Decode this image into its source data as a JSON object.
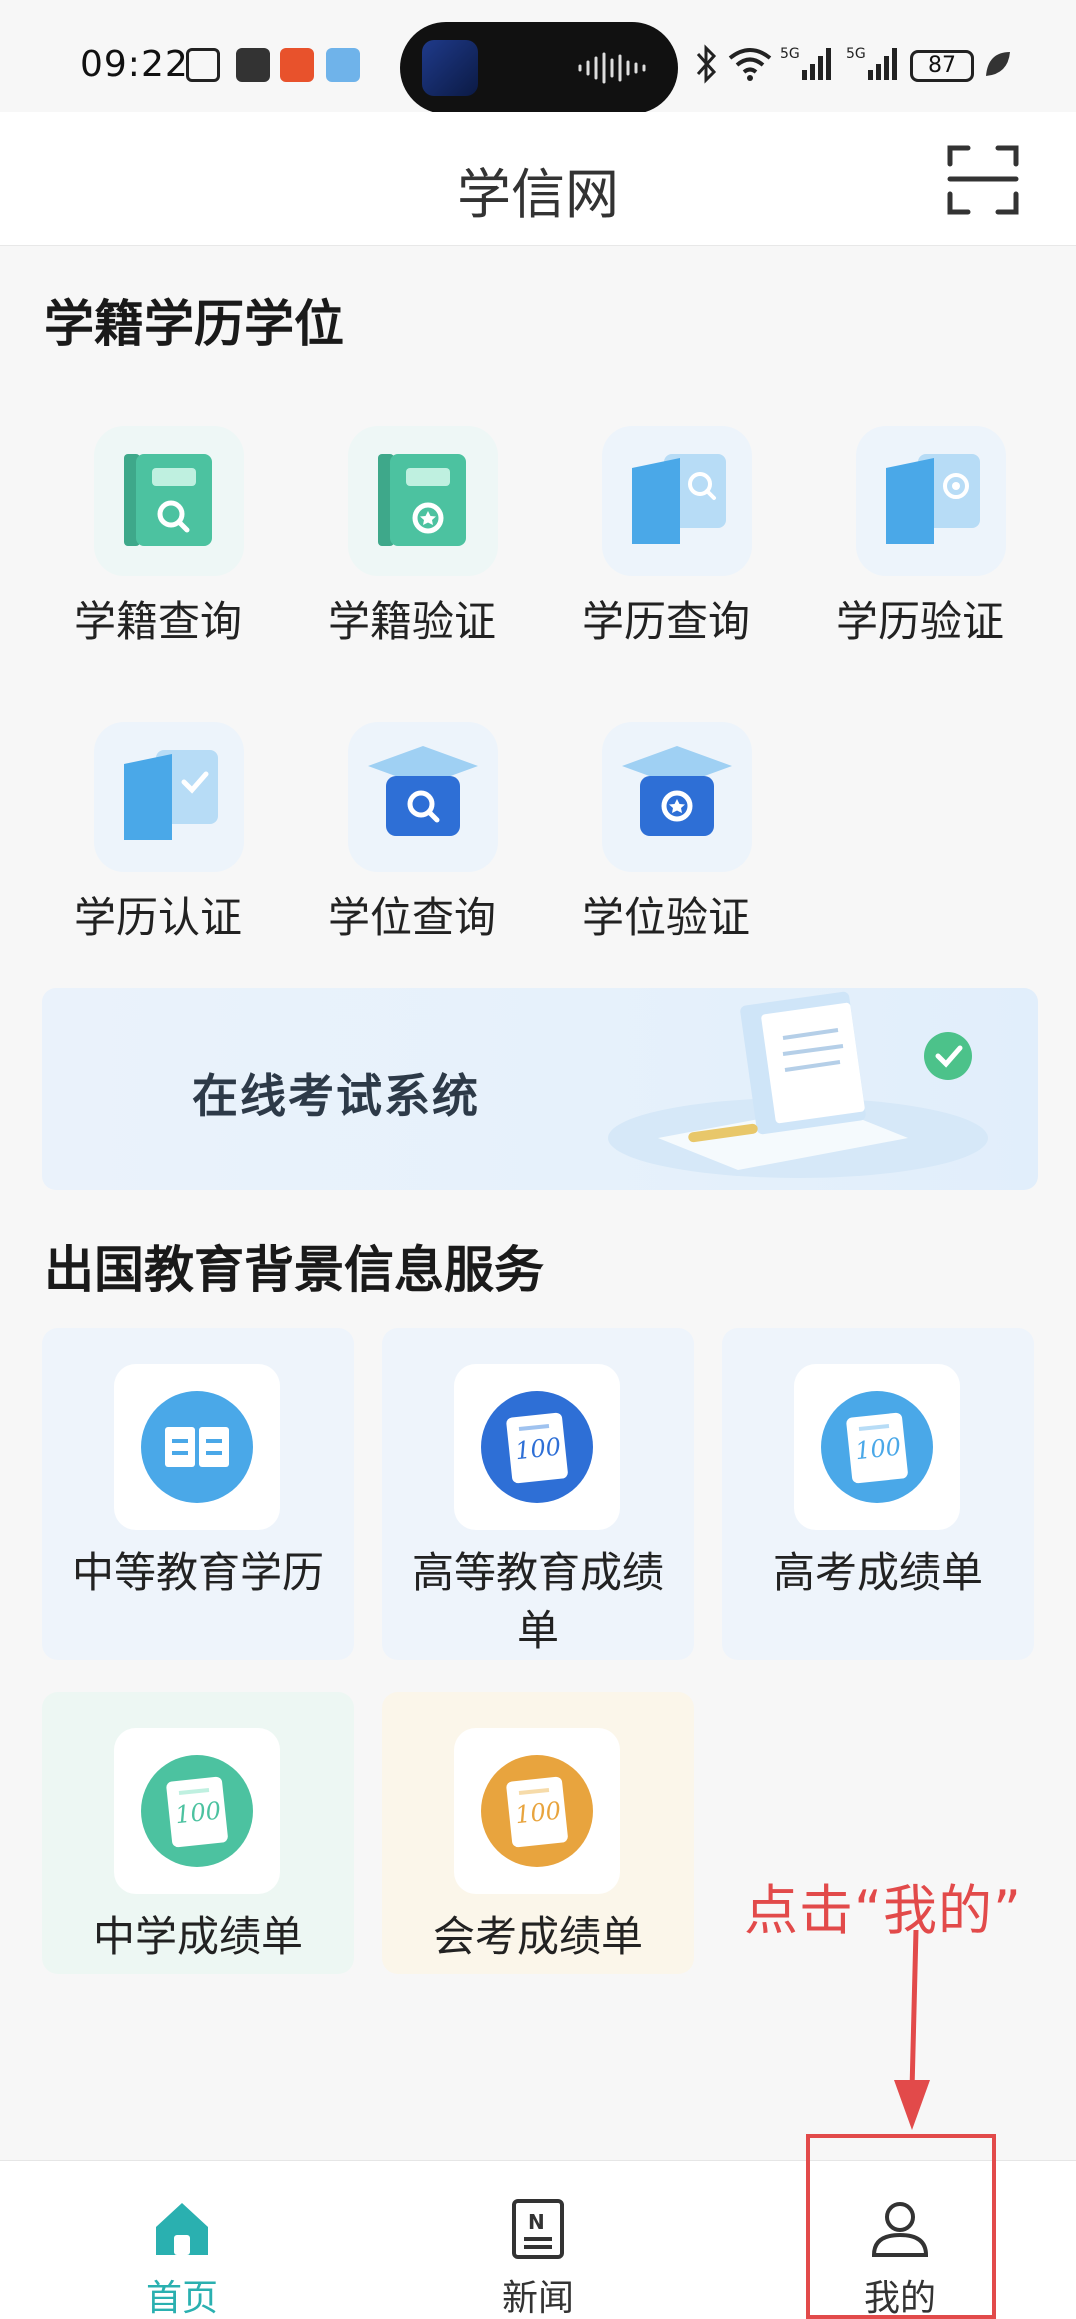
{
  "status_bar": {
    "time": "09:22",
    "battery": "87"
  },
  "header": {
    "title": "学信网",
    "scan_icon": "scan-icon"
  },
  "section_degree": {
    "title": "学籍学历学位",
    "items": [
      {
        "label": "学籍查询",
        "icon": "book-search-icon"
      },
      {
        "label": "学籍验证",
        "icon": "book-verify-icon"
      },
      {
        "label": "学历查询",
        "icon": "folder-search-icon"
      },
      {
        "label": "学历验证",
        "icon": "folder-verify-icon"
      },
      {
        "label": "学历认证",
        "icon": "folder-check-icon"
      },
      {
        "label": "学位查询",
        "icon": "cap-search-icon"
      },
      {
        "label": "学位验证",
        "icon": "cap-verify-icon"
      }
    ]
  },
  "banner": {
    "text": "在线考试系统"
  },
  "section_abroad": {
    "title": "出国教育背景信息服务",
    "items": [
      {
        "label": "中等教育学历",
        "icon": "open-book-icon"
      },
      {
        "label": "高等教育成绩单",
        "icon": "score-sheet-icon"
      },
      {
        "label": "高考成绩单",
        "icon": "score-sheet-icon"
      },
      {
        "label": "中学成绩单",
        "icon": "score-sheet-icon"
      },
      {
        "label": "会考成绩单",
        "icon": "score-sheet-icon"
      }
    ]
  },
  "annotation": {
    "text": "点击“我的”"
  },
  "bottom_nav": {
    "items": [
      {
        "label": "首页",
        "icon": "home-icon",
        "active": true
      },
      {
        "label": "新闻",
        "icon": "news-icon",
        "active": false
      },
      {
        "label": "我的",
        "icon": "user-icon",
        "active": false
      }
    ]
  },
  "colors": {
    "accent": "#2ab0b0",
    "annotation": "#e24a4a",
    "green_icon": "#4cc2a0",
    "blue_icon": "#4aa8e8",
    "dark_blue_icon": "#2e6fd6",
    "orange_icon": "#e8a43e"
  }
}
